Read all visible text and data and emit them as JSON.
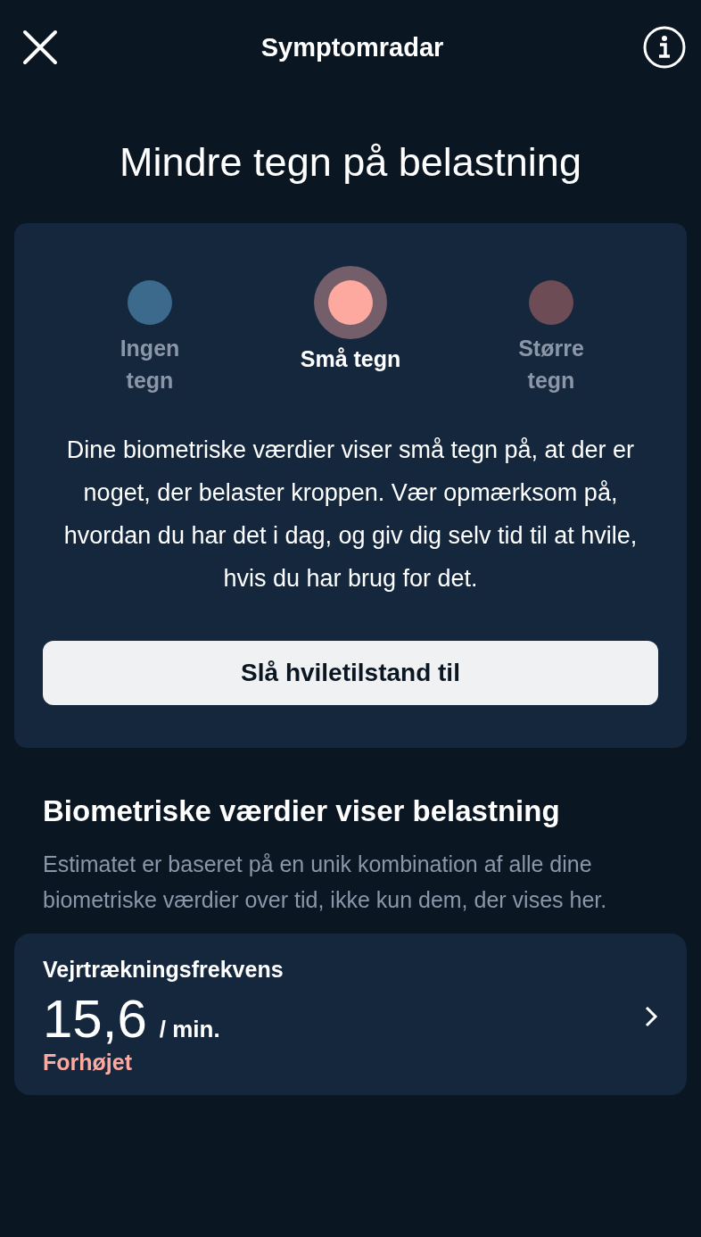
{
  "header": {
    "title": "Symptomradar"
  },
  "headline": "Mindre tegn på belastning",
  "levels": [
    {
      "label": "Ingen tegn",
      "color": "#3b6a8c",
      "selected": false
    },
    {
      "label": "Små tegn",
      "color": "#fda9a0",
      "selected": true
    },
    {
      "label": "Større tegn",
      "color": "#6e4c55",
      "selected": false
    }
  ],
  "description": "Dine biometriske værdier viser små tegn på, at der er noget, der belaster kroppen. Vær opmærksom på, hvordan du har det i dag, og giv dig selv tid til at hvile, hvis du har brug for det.",
  "action_button": "Slå hviletilstand til",
  "section": {
    "title": "Biometriske værdier viser belastning",
    "subtitle": "Estimatet er baseret på en unik kombination af alle dine biometriske værdier over tid, ikke kun dem, der vises her."
  },
  "metrics": [
    {
      "name": "Vejrtrækningsfrekvens",
      "value": "15,6",
      "unit": "/ min.",
      "status": "Forhøjet"
    }
  ]
}
